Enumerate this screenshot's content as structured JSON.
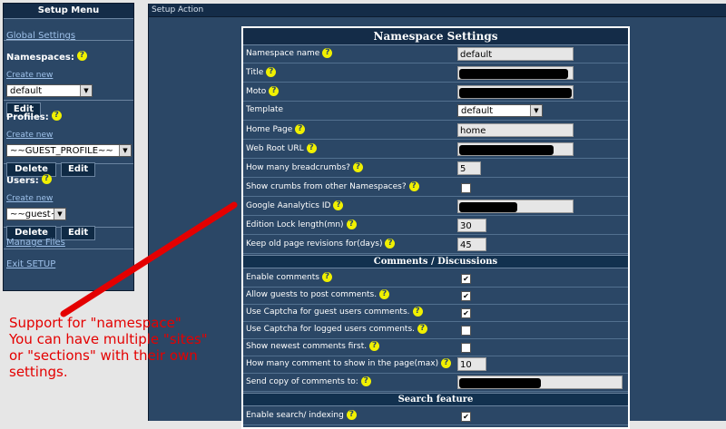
{
  "sidebar": {
    "title": "Setup Menu",
    "global_settings": "Global Settings",
    "namespaces_label": "Namespaces:",
    "namespaces_create": "Create new",
    "namespaces_selected": "default",
    "namespaces_edit": "Edit",
    "profiles_label": "Profiles:",
    "profiles_create": "Create new",
    "profiles_selected": "~~GUEST_PROFILE~~",
    "profiles_delete": "Delete",
    "profiles_edit": "Edit",
    "users_label": "Users:",
    "users_create": "Create new",
    "users_selected": "~~guest~~",
    "users_delete": "Delete",
    "users_edit": "Edit",
    "manage_files": "Manage Files",
    "exit_setup": "Exit SETUP"
  },
  "main": {
    "header": "Setup Action",
    "panel_title": "Namespace Settings",
    "help_glyph": "?",
    "rows": [
      {
        "label": "Namespace name",
        "value": "default"
      },
      {
        "label": "Title",
        "value": ""
      },
      {
        "label": "Moto",
        "value": ""
      },
      {
        "label": "Template",
        "value": "default"
      },
      {
        "label": "Home Page",
        "value": "home"
      },
      {
        "label": "Web Root URL",
        "value": ""
      },
      {
        "label": "How many breadcrumbs?",
        "value": "5"
      },
      {
        "label": "Show crumbs from other Namespaces?",
        "checked": false
      },
      {
        "label": "Google Aanalytics ID",
        "value": ""
      },
      {
        "label": "Edition Lock length(mn)",
        "value": "30"
      },
      {
        "label": "Keep old page revisions for(days)",
        "value": "45"
      }
    ],
    "comments_title": "Comments / Discussions",
    "comment_rows": [
      {
        "label": "Enable comments",
        "checked": true
      },
      {
        "label": "Allow guests to post comments.",
        "checked": true
      },
      {
        "label": "Use Captcha for guest users comments.",
        "checked": true
      },
      {
        "label": "Use Captcha for logged users comments.",
        "checked": false
      },
      {
        "label": "Show newest comments first.",
        "checked": false
      },
      {
        "label": "How many comment to show in the page(max)",
        "value": "10"
      },
      {
        "label": "Send copy of comments to:",
        "value": ""
      }
    ],
    "search_title": "Search feature",
    "search_rows": [
      {
        "label": "Enable search/ indexing",
        "checked": true
      }
    ]
  },
  "annotation": {
    "line1": "Support for \"namespace\"",
    "line2": "You can have multiple \"sites\"",
    "line3": "or \"sections\" with their own",
    "line4": "settings."
  },
  "colors": {
    "panel_bg": "#2b4766",
    "header_bg": "#142c48",
    "annotation_red": "#e40000",
    "help_yellow": "#f0f000"
  }
}
